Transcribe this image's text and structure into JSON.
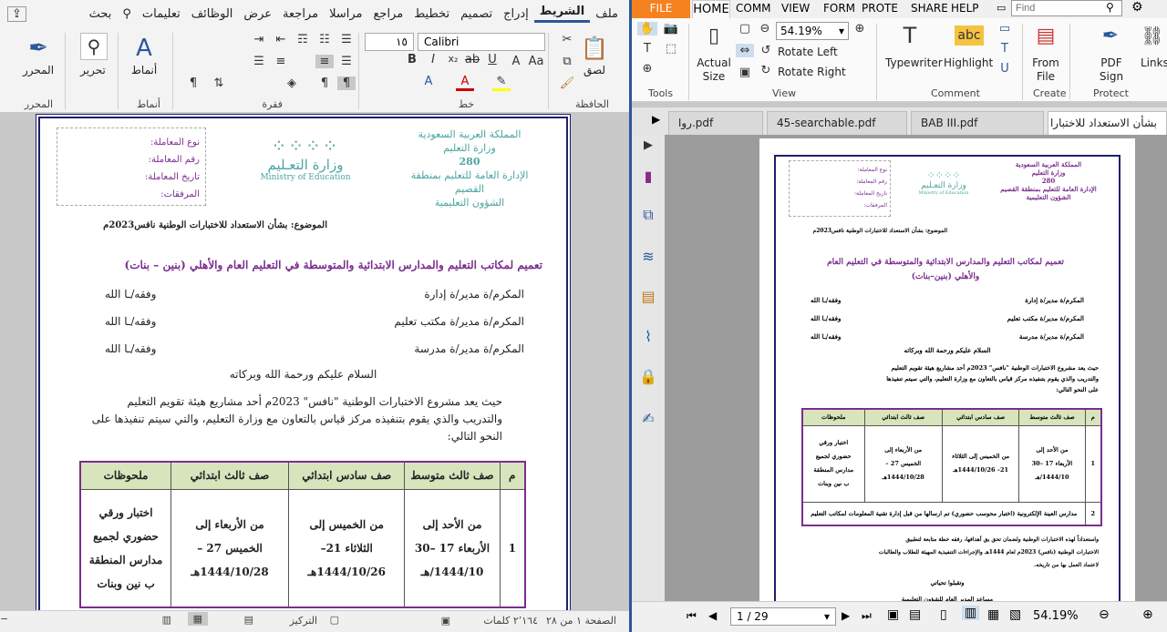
{
  "word": {
    "tabs": [
      "ملف",
      "الشريط",
      "إدراج",
      "تصميم",
      "تخطيط",
      "مراجع",
      "مراسلا",
      "مراجعة",
      "عرض",
      "الوظائف",
      "تعليمات",
      "بحث"
    ],
    "font_name": "Calibri",
    "font_size": "١٥",
    "group_labels": {
      "editor": "المحرر",
      "styles": "أنماط",
      "paragraph": "فقرة",
      "font": "خط",
      "clipboard": "الحافظة"
    },
    "buttons": {
      "editor": "المحرر",
      "edit": "تحرير",
      "styles": "أنماط",
      "paste": "لصق"
    },
    "doc": {
      "ministry": [
        "المملكة العربية السعودية",
        "وزارة التعليم",
        "280",
        "الإدارة العامة للتعليم بمنطقة القصيم",
        "الشؤون  التعليمية"
      ],
      "logo_ar": "وزارة التعـليم",
      "logo_en": "Ministry of Education",
      "fields": [
        "نوع المعاملة:",
        "رقم المعاملة:",
        "تاريخ المعاملة:",
        "المرفقات:"
      ],
      "subject": "الموضوع: بشأن الاستعداد للاختبارات الوطنية نافس2023م",
      "title": "تعميم لمكاتب التعليم والمدارس الابتدائية والمتوسطة في التعليم العام والأهلي (بنين – بنات)",
      "addressees": [
        {
          "to": "المكرم/ة مدير/ة إدارة",
          "wish": "وفقه/ـا الله"
        },
        {
          "to": "المكرم/ة مدير/ة مكتب تعليم",
          "wish": "وفقه/ـا الله"
        },
        {
          "to": "المكرم/ة مدير/ة مدرسة",
          "wish": "وفقه/ـا الله"
        }
      ],
      "greeting": "السلام عليكم ورحمة الله وبركاته",
      "body": [
        "حيث يعد مشروع الاختبارات الوطنية \"نافس\" 2023م أحد مشاريع هيئة تقويم التعليم",
        "والتدريب والذي يقوم بتنفيذه مركز قياس بالتعاون مع وزارة التعليم، والتي سيتم تنفيذها على",
        "النحو التالي:"
      ],
      "table_headers": [
        "م",
        "صف ثالث متوسط",
        "صف سادس ابتدائي",
        "صف ثالث ابتدائي",
        "ملحوظات"
      ],
      "table_row1": [
        "1",
        "من الأحد إلى الأربعاء 17 –30 1444/10/هـ",
        "من الخميس إلى الثلاثاء 21– 1444/10/26هـ",
        "من الأربعاء إلى الخميس 27 – 1444/10/28هـ",
        "اختبار ورقي حضوري لجميع مدارس المنطقة ب نين وبنات"
      ]
    },
    "status": {
      "page": "الصفحة ١ من ٢٨",
      "words": "٢٬١٦٤ كلمات",
      "focus": "التركيز"
    }
  },
  "pdf": {
    "menu": [
      "FILE",
      "HOME",
      "COMM",
      "VIEW",
      "FORM",
      "PROTE",
      "SHARE",
      "HELP"
    ],
    "find_placeholder": "Find",
    "zoom": "54.19%",
    "ribbon": {
      "actual_size": "Actual Size",
      "rotate_left": "Rotate Left",
      "rotate_right": "Rotate Right",
      "typewriter": "Typewriter",
      "highlight": "Highlight",
      "from_file": "From File",
      "pdf_sign": "PDF Sign",
      "links": "Links",
      "groups": {
        "tools": "Tools",
        "view": "View",
        "comment": "Comment",
        "create": "Create",
        "protect": "Protect"
      }
    },
    "tabs": [
      "روا.pdf",
      "45-searchable.pdf",
      "BAB III.pdf",
      "بشأن الاستعداد للاختبارا"
    ],
    "page": {
      "ministry": [
        "المملكة العربية السعودية",
        "وزارة التعليم",
        "280",
        "الإدارة العامة للتعليم بمنطقة القصيم",
        "الشؤون  التعليمية"
      ],
      "subject": "الموضوع: بشأن الاستعداد للاختبارات الوطنية نافس2023م",
      "title1": "تعميم لمكاتب التعليم والمدارس الابتدائية والمتوسطة في التعليم العام",
      "title2": "والأهلي (بنين–بنات)",
      "addressees": [
        {
          "to": "المكرم/ة مدير/ة إدارة",
          "wish": "وفقه/ـا الله"
        },
        {
          "to": "المكرم/ة مدير/ة مكتب تعليم",
          "wish": "وفقه/ـا الله"
        },
        {
          "to": "المكرم/ة مدير/ة مدرسة",
          "wish": "وفقه/ـا الله"
        }
      ],
      "greeting": "السلام عليكم ورحمة الله وبركاته",
      "body": [
        "حيث يعد مشروع الاختبارات الوطنية \"نافس\" 2023م أحد مشاريع هيئة تقويم التعليم",
        "والتدريب والذي يقوم بتنفيذه مركز قياس بالتعاون مع وزارة التعليم، والتي سيتم تنفيذها",
        "على النحو التالي:"
      ],
      "table_headers": [
        "م",
        "صف ثالث متوسط",
        "صف سادس ابتدائي",
        "صف ثالث ابتدائي",
        "ملحوظات"
      ],
      "table_row1": [
        "1",
        "من الأحد إلى الأربعاء 17 –30 1444/10/هـ",
        "من الخميس إلى الثلاثاء 21– 1444/10/26هـ",
        "من الأربعاء إلى الخميس 27 – 1444/10/28هـ",
        "اختبار ورقي حضوري لجميع مدارس المنطقة ب نين وبنات"
      ],
      "table_row2": [
        "2",
        "مدارس العينة الإلكترونية (اختبار محوسب حضوري) تم ارسالها من قبل إدارة تقنية المعلومات لمكاتب التعليم"
      ],
      "after": [
        "واستعداداً لهذه الاختبارات الوطنية ولضمان تحق يق أهدافها، رفقه خطة متابعة لتطبيق",
        "الاختبارات الوطنية (نافس) 2023م لعام 1444هـ والإجراءات التنفيذية المهيئة للطلاب والطالبات",
        "لاعتماد العمل بها من تاريخه."
      ],
      "closing": "وتقبلوا تحياتي",
      "sign": "مساعد المدير العام للشؤون التعليمية"
    },
    "page_nav": "1 / 29",
    "bottom_zoom": "54.19%"
  },
  "colors": {
    "word_accent": "#2b579a",
    "pdf_file": "#f5821f",
    "purple": "#7b2d8f",
    "table_green": "#d8e4bc",
    "frame_navy": "#1f1f6b"
  }
}
